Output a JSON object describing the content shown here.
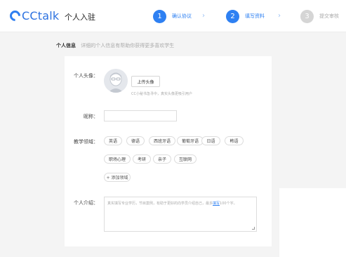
{
  "header": {
    "logo_text": "CCtalk",
    "page_title": "个人入驻",
    "steps": [
      {
        "num": "1",
        "label": "确认协议",
        "state": "active"
      },
      {
        "num": "2",
        "label": "填写资料",
        "state": "active"
      },
      {
        "num": "3",
        "label": "提交审核",
        "state": "inactive"
      }
    ],
    "chevron": "›"
  },
  "section": {
    "title": "个人信息",
    "subtitle": "详细的个人信息有帮助你获得更多喜欢学生"
  },
  "form": {
    "avatar_label": "个人头像：",
    "upload_label": "上传头像",
    "avatar_hint": "CC小秘书急寻中，真实头像更吸引用户",
    "nickname_label": "昵称：",
    "nickname_value": "",
    "domain_label": "教学领域：",
    "domain_tags": [
      "英语",
      "德语",
      "西班牙语",
      "葡萄牙语",
      "日语",
      "韩语",
      "职场心理",
      "考研",
      "亲子",
      "互联网"
    ],
    "add_domain_label": "+ 添加领域",
    "intro_label": "个人介绍：",
    "intro_placeholder_pre": "真实填写专业学历，节目案例，有助于更好的向学员介绍自己，最多",
    "intro_placeholder_link": "填写",
    "intro_placeholder_post": "100个字。"
  },
  "colors": {
    "accent": "#2e80f2",
    "inactive_step": "#d5d5d5",
    "page_bg": "#f4f4f4"
  }
}
